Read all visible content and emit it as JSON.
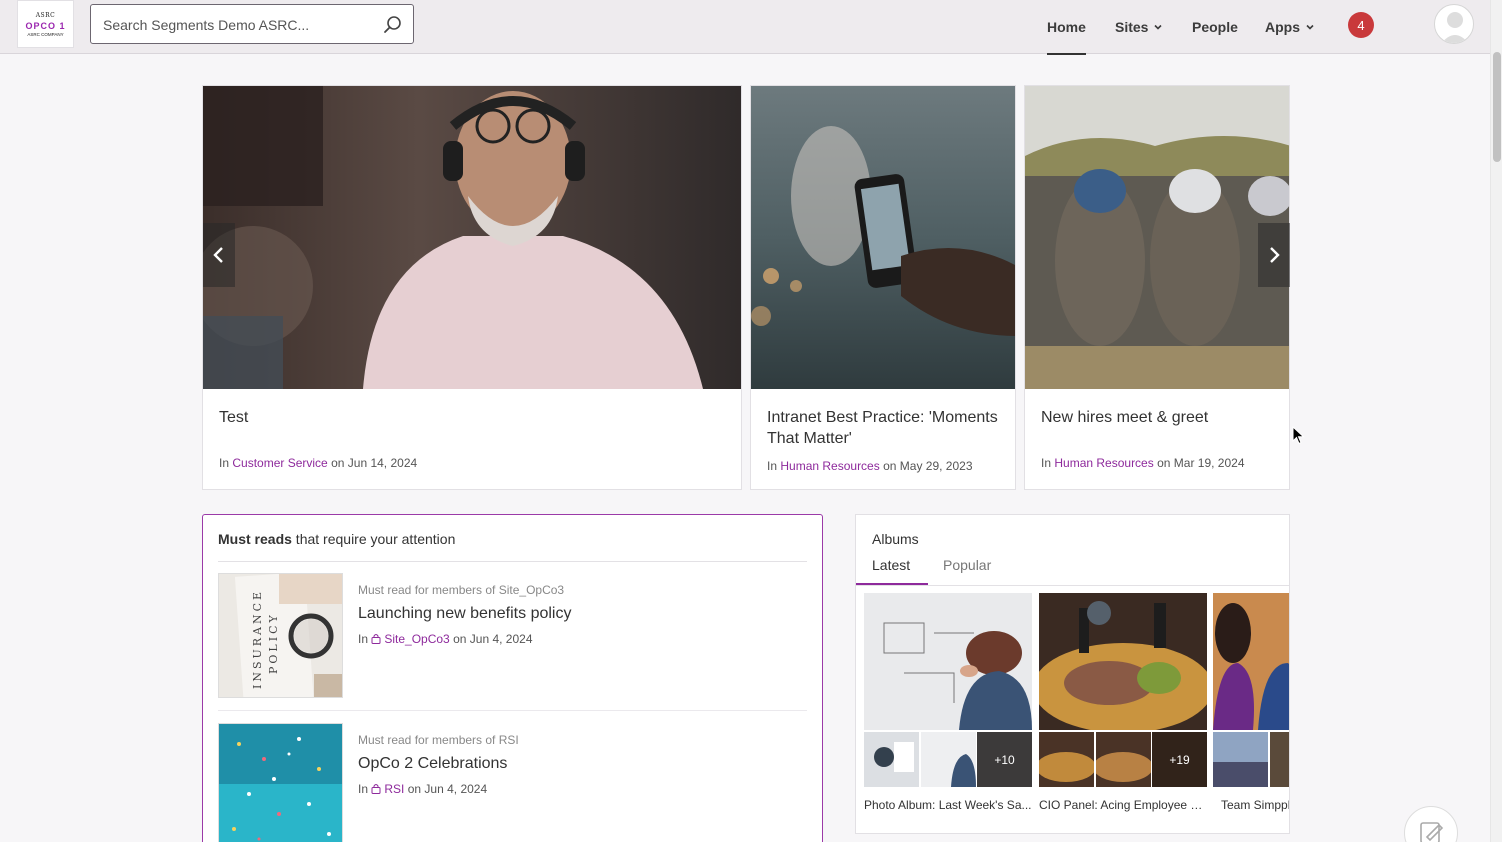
{
  "header": {
    "logo": {
      "line1": "ASRC",
      "line2": "OPCO 1",
      "line3": "ASRC COMPANY"
    },
    "search_placeholder": "Search Segments Demo ASRC...",
    "nav": {
      "home": "Home",
      "sites": "Sites",
      "people": "People",
      "apps": "Apps"
    },
    "notifications_count": "4"
  },
  "carousel": [
    {
      "title": "Test",
      "prefix": "In",
      "site": "Customer Service",
      "date_prefix": "on",
      "date": "Jun 14, 2024"
    },
    {
      "title": "Intranet Best Practice: 'Moments That Matter'",
      "prefix": "In",
      "site": "Human Resources",
      "date_prefix": "on",
      "date": "May 29, 2023"
    },
    {
      "title": "New hires meet & greet",
      "prefix": "In",
      "site": "Human Resources",
      "date_prefix": "on",
      "date": "Mar 19, 2024"
    }
  ],
  "must_reads": {
    "heading_bold": "Must reads",
    "heading_rest": " that require your attention",
    "items": [
      {
        "subtitle": "Must read for members of Site_OpCo3",
        "title": "Launching new benefits policy",
        "prefix": "In",
        "site": "Site_OpCo3",
        "date_prefix": "on",
        "date": "Jun 4, 2024"
      },
      {
        "subtitle": "Must read for members of RSI",
        "title": "OpCo 2 Celebrations",
        "prefix": "In",
        "site": "RSI",
        "date_prefix": "on",
        "date": "Jun 4, 2024"
      }
    ]
  },
  "albums": {
    "title": "Albums",
    "tabs": [
      "Latest",
      "Popular"
    ],
    "items": [
      {
        "caption": "Photo Album: Last Week's Sa...",
        "more": "+10"
      },
      {
        "caption": "CIO Panel: Acing Employee E...",
        "more": "+19"
      },
      {
        "caption": "Team Simppl",
        "more": ""
      }
    ]
  },
  "colors": {
    "accent": "#8e2a9c",
    "badge": "#c9393b",
    "header_bg": "#eeebee"
  }
}
